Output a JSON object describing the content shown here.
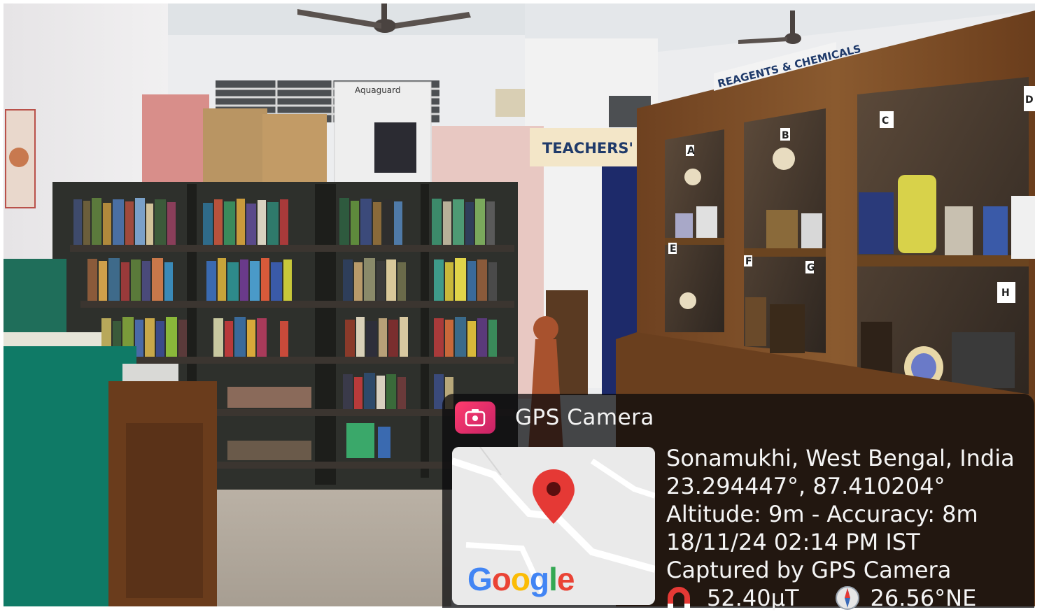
{
  "overlay": {
    "app_name": "GPS Camera",
    "location": "Sonamukhi, West Bengal, India",
    "coordinates": "23.294447°, 87.410204°",
    "altitude_accuracy": "Altitude: 9m - Accuracy: 8m",
    "datetime": "18/11/24 02:14 PM IST",
    "captured_by": "Captured by GPS Camera",
    "magnetic_field": "52.40μT",
    "compass": "26.56°NE",
    "map_logo": "Google",
    "icons": [
      "gps-camera-app-icon",
      "map-pin-icon",
      "magnet-icon",
      "compass-icon"
    ]
  },
  "scene": {
    "signs": {
      "teachers": "TEACHERS' CA",
      "reagents": "REAGENTS & CHEMICALS",
      "box_brand": "Aquaguard"
    },
    "cabinet_labels": [
      "A",
      "B",
      "C",
      "D",
      "E",
      "F",
      "G",
      "H"
    ]
  },
  "colors": {
    "overlay_bg": "#0a0a0c",
    "app_icon": "#e8336a",
    "map_pin": "#e53935",
    "cabinet_wood": "#7a4a22",
    "bookshelf": "#2e302c",
    "wall": "#eceef0"
  }
}
